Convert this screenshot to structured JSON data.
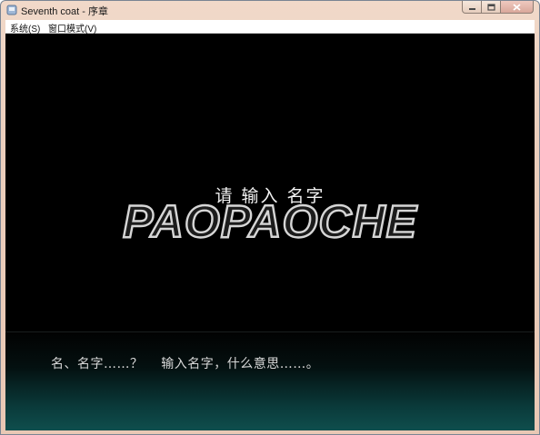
{
  "window": {
    "title": "Seventh coat - 序章"
  },
  "menubar": {
    "items": [
      {
        "label": "系统(S)"
      },
      {
        "label": "窗口模式(V)"
      }
    ]
  },
  "game": {
    "prompt": "请 输入 名字",
    "watermark": "PAOPAOCHE",
    "dialogue": "名、名字……？    输入名字，什么意思……。"
  },
  "icons": {
    "app": "app-icon",
    "minimize": "minimize-icon",
    "maximize": "maximize-icon",
    "close": "close-icon"
  },
  "colors": {
    "title_bar": "#eccfbd",
    "game_background": "#000000",
    "message_box_bottom": "#0f4f4e",
    "text": "#d8d8d8"
  }
}
